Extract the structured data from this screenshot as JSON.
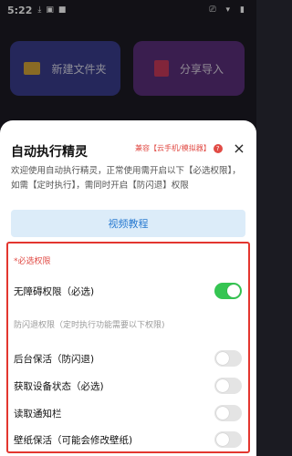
{
  "status_bar": {
    "time": "5:22",
    "left_icons": [
      "download-icon",
      "notification-a-icon",
      "notification-square-icon"
    ],
    "right_icons": [
      "cast-icon",
      "wifi-icon",
      "battery-icon"
    ]
  },
  "background": {
    "card_left_label": "新建文件夹",
    "card_right_label": "分享导入"
  },
  "sheet": {
    "title": "自动执行精灵",
    "compat_text": "兼容【云手机/模拟器】",
    "close_glyph": "×",
    "intro": "欢迎使用自动执行精灵，正常使用需开启以下【必选权限】，如需【定时执行】，需同时开启【防闪退】权限",
    "video_button": "视频教程"
  },
  "permissions": {
    "required_header": "*必选权限",
    "items": [
      {
        "label": "无障碍权限（必选)",
        "enabled": true
      },
      {
        "label": "后台保活（防闪退)",
        "enabled": false
      },
      {
        "label": "获取设备状态（必选)",
        "enabled": false
      },
      {
        "label": "读取通知栏",
        "enabled": false
      },
      {
        "label": "壁纸保活（可能会修改壁纸)",
        "enabled": false
      }
    ],
    "anti_crash_note": "防闪退权限（定时执行功能需要以下权限)"
  },
  "colors": {
    "accent_red": "#e3362f",
    "toggle_on": "#35c552",
    "video_button_bg": "#dcecf9",
    "video_button_text": "#2a7bd1"
  }
}
